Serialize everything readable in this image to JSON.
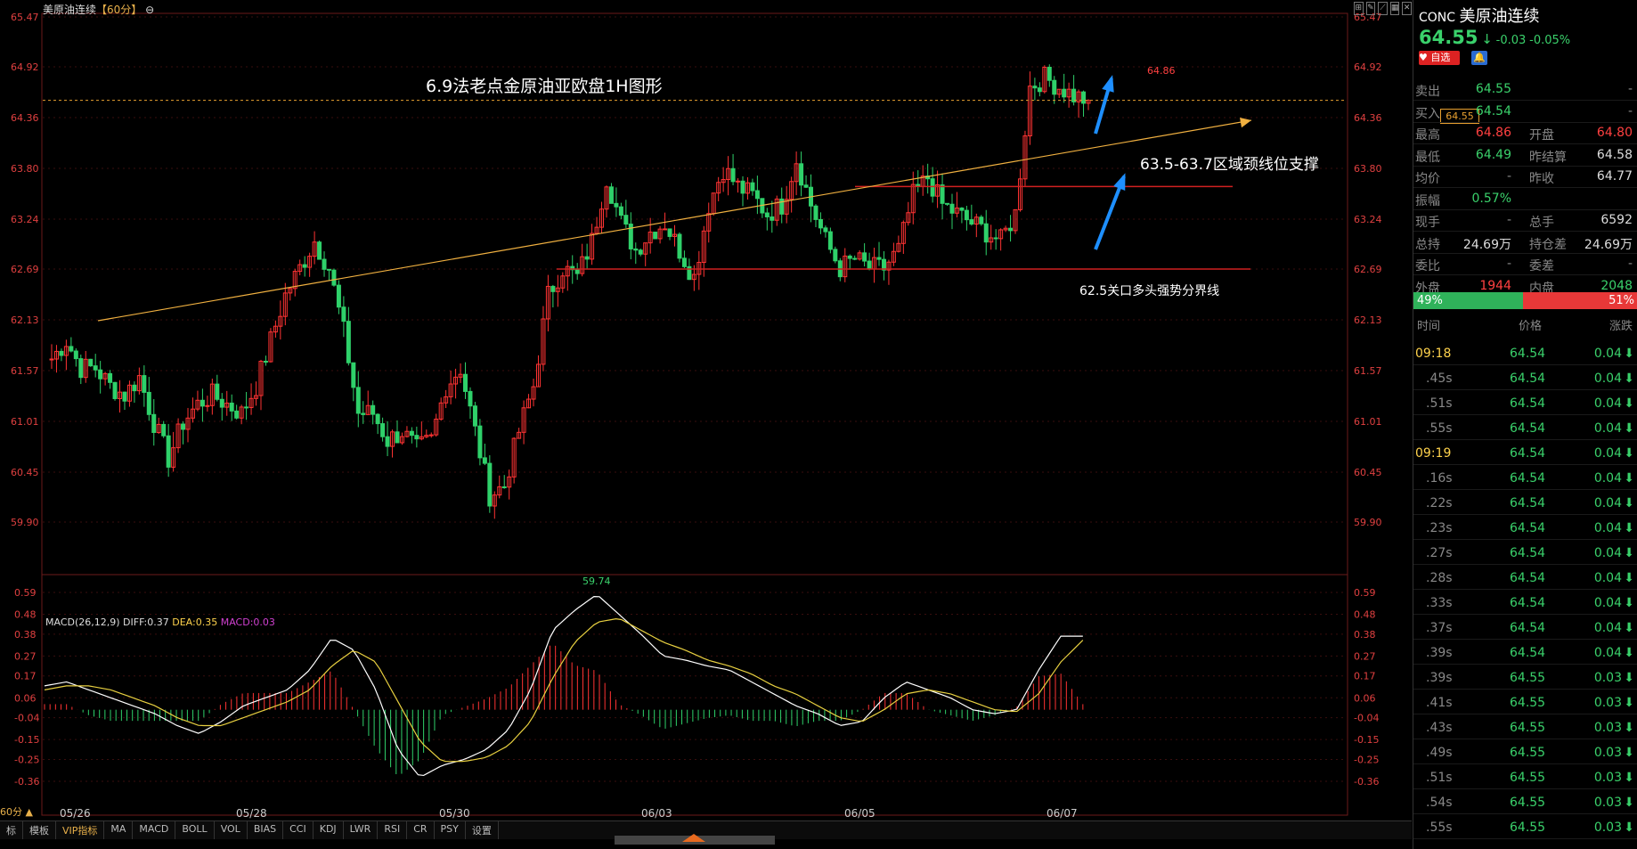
{
  "chart_header": {
    "symbol": "美原油连续",
    "period": "【60分】",
    "period_icon": "⊖"
  },
  "price_axis": [
    "65.47",
    "64.92",
    "64.36",
    "63.80",
    "63.24",
    "62.69",
    "62.13",
    "61.57",
    "61.01",
    "60.45",
    "59.90"
  ],
  "current_price_tag": "64.55",
  "annotations": {
    "main_title": "6.9法老点金原油亚欧盘1H图形",
    "neckline": "63.5-63.7区域颈线位支撑",
    "boundary": "62.5关口多头强势分界线",
    "high_label": "64.86",
    "low_label": "59.74"
  },
  "macd": {
    "label": "MACD(26,12,9)",
    "diff": "DIFF:0.37",
    "dea": "DEA:0.35",
    "macd_val": "MACD:0.03",
    "axis": [
      "0.59",
      "0.48",
      "0.38",
      "0.27",
      "0.17",
      "0.06",
      "-0.04",
      "-0.15",
      "-0.25",
      "-0.36"
    ]
  },
  "date_axis": [
    "05/26",
    "05/28",
    "05/30",
    "06/03",
    "06/05",
    "06/07"
  ],
  "period_selector": "60分 ▲",
  "bottom_tabs": [
    "标",
    "模板",
    "VIP指标",
    "MA",
    "MACD",
    "BOLL",
    "VOL",
    "BIAS",
    "CCI",
    "KDJ",
    "LWR",
    "RSI",
    "CR",
    "PSY",
    "设置"
  ],
  "colors": {
    "up": "#ff3333",
    "down": "#2fd16a",
    "trend": "#f0b040",
    "level": "#d02020",
    "arrow": "#1e8fff"
  },
  "quote": {
    "code": "CONC",
    "name": "美原油连续",
    "price": "64.55",
    "arrow": "↓",
    "change": "-0.03",
    "pct": "-0.05%",
    "btn_watch": "自选",
    "bell_icon": "bell-icon",
    "rows": [
      {
        "l1": "卖出",
        "v1": "64.55",
        "l2": "",
        "v2": "-"
      },
      {
        "l1": "买入",
        "v1": "64.54",
        "l2": "",
        "v2": "-"
      },
      {
        "l1": "最高",
        "v1": "64.86",
        "l2": "开盘",
        "v2": "64.80"
      },
      {
        "l1": "最低",
        "v1": "64.49",
        "l2": "昨结算",
        "v2": "64.58"
      },
      {
        "l1": "均价",
        "v1": "-",
        "l2": "昨收",
        "v2": "64.77"
      },
      {
        "l1": "振幅",
        "v1": "0.57%",
        "l2": "",
        "v2": ""
      },
      {
        "l1": "现手",
        "v1": "-",
        "l2": "总手",
        "v2": "6592"
      },
      {
        "l1": "总持",
        "v1": "24.69万",
        "l2": "持仓差",
        "v2": "24.69万"
      },
      {
        "l1": "委比",
        "v1": "-",
        "l2": "委差",
        "v2": "-"
      },
      {
        "l1": "外盘",
        "v1": "1944",
        "l2": "内盘",
        "v2": "2048"
      }
    ],
    "buy_pct": "49%",
    "sell_pct": "51%",
    "buy_ratio": 0.49,
    "tick_header": [
      "时间",
      "价格",
      "涨跌"
    ],
    "ticks": [
      {
        "t": "09:18",
        "p": "64.54",
        "c": "0.04"
      },
      {
        "t": ".45s",
        "p": "64.54",
        "c": "0.04"
      },
      {
        "t": ".51s",
        "p": "64.54",
        "c": "0.04"
      },
      {
        "t": ".55s",
        "p": "64.54",
        "c": "0.04"
      },
      {
        "t": "09:19",
        "p": "64.54",
        "c": "0.04"
      },
      {
        "t": ".16s",
        "p": "64.54",
        "c": "0.04"
      },
      {
        "t": ".22s",
        "p": "64.54",
        "c": "0.04"
      },
      {
        "t": ".23s",
        "p": "64.54",
        "c": "0.04"
      },
      {
        "t": ".27s",
        "p": "64.54",
        "c": "0.04"
      },
      {
        "t": ".28s",
        "p": "64.54",
        "c": "0.04"
      },
      {
        "t": ".33s",
        "p": "64.54",
        "c": "0.04"
      },
      {
        "t": ".37s",
        "p": "64.54",
        "c": "0.04"
      },
      {
        "t": ".39s",
        "p": "64.54",
        "c": "0.04"
      },
      {
        "t": ".39s",
        "p": "64.55",
        "c": "0.03"
      },
      {
        "t": ".41s",
        "p": "64.55",
        "c": "0.03"
      },
      {
        "t": ".43s",
        "p": "64.55",
        "c": "0.03"
      },
      {
        "t": ".49s",
        "p": "64.55",
        "c": "0.03"
      },
      {
        "t": ".51s",
        "p": "64.55",
        "c": "0.03"
      },
      {
        "t": ".54s",
        "p": "64.55",
        "c": "0.03"
      },
      {
        "t": ".55s",
        "p": "64.55",
        "c": "0.03"
      }
    ]
  },
  "chart_data": {
    "type": "candlestick",
    "title": "6.9法老点金原油亚欧盘1H图形",
    "y_range": [
      59.74,
      64.86
    ],
    "x_dates": [
      "05/26",
      "05/28",
      "05/30",
      "06/03",
      "06/05",
      "06/07"
    ],
    "horizontal_levels": [
      63.6,
      62.69
    ],
    "last_price": 64.55,
    "close_path": [
      61.7,
      61.9,
      61.6,
      61.6,
      61.4,
      61.3,
      61.5,
      61.0,
      60.6,
      61.0,
      61.2,
      61.3,
      61.2,
      61.1,
      61.4,
      61.9,
      62.4,
      62.7,
      63.0,
      62.7,
      62.0,
      61.1,
      61.1,
      60.8,
      60.9,
      60.7,
      60.8,
      61.4,
      61.6,
      60.9,
      60.2,
      60.3,
      60.9,
      61.4,
      62.4,
      62.7,
      62.6,
      63.0,
      63.7,
      63.2,
      62.9,
      63.1,
      63.2,
      62.9,
      62.6,
      63.4,
      63.8,
      63.6,
      63.5,
      63.3,
      63.4,
      63.9,
      63.4,
      63.0,
      62.7,
      62.8,
      62.7,
      62.7,
      62.9,
      63.5,
      63.7,
      63.4,
      63.3,
      63.2,
      63.1,
      63.0,
      63.3,
      64.7,
      64.8,
      64.7,
      64.6,
      64.55
    ],
    "macd_diff": [
      0.12,
      0.14,
      0.1,
      0.06,
      0.02,
      -0.02,
      -0.08,
      -0.12,
      -0.06,
      0.02,
      0.06,
      0.1,
      0.2,
      0.36,
      0.3,
      0.1,
      -0.2,
      -0.34,
      -0.28,
      -0.25,
      -0.2,
      -0.1,
      0.1,
      0.4,
      0.5,
      0.58,
      0.48,
      0.38,
      0.27,
      0.25,
      0.22,
      0.2,
      0.14,
      0.08,
      0.02,
      -0.02,
      -0.08,
      -0.06,
      0.06,
      0.14,
      0.1,
      0.06,
      0.0,
      -0.02,
      0.0,
      0.2,
      0.37,
      0.37
    ],
    "macd_dea": [
      0.1,
      0.12,
      0.12,
      0.1,
      0.06,
      0.02,
      -0.04,
      -0.08,
      -0.08,
      -0.04,
      0.0,
      0.04,
      0.1,
      0.22,
      0.3,
      0.24,
      0.04,
      -0.16,
      -0.26,
      -0.26,
      -0.24,
      -0.18,
      -0.06,
      0.16,
      0.34,
      0.44,
      0.46,
      0.4,
      0.34,
      0.3,
      0.25,
      0.22,
      0.18,
      0.12,
      0.08,
      0.02,
      -0.04,
      -0.06,
      0.0,
      0.08,
      0.1,
      0.08,
      0.04,
      0.0,
      -0.01,
      0.08,
      0.24,
      0.35
    ]
  }
}
